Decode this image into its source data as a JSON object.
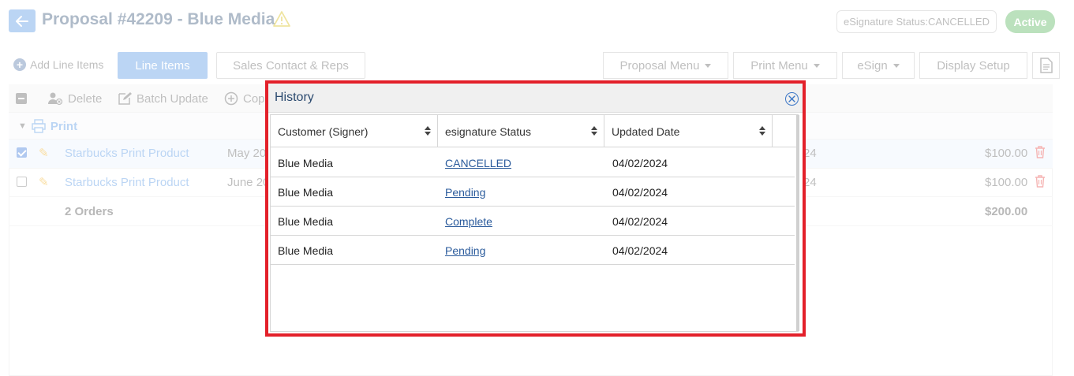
{
  "header": {
    "title": "Proposal #42209 - Blue Media",
    "esignature_status": "eSignature Status:CANCELLED",
    "status_badge": "Active"
  },
  "toolbar": {
    "add_line_items": "Add Line Items",
    "tab_line_items": "Line Items",
    "tab_sales_contact": "Sales Contact & Reps",
    "proposal_menu": "Proposal Menu",
    "print_menu": "Print Menu",
    "esign": "eSign",
    "display_setup": "Display Setup"
  },
  "grid_toolbar": {
    "delete": "Delete",
    "batch_update": "Batch Update",
    "copy": "Cop"
  },
  "grid": {
    "group_label": "Print",
    "rows": [
      {
        "product": "Starbucks Print Product",
        "date": "May 20",
        "col3": "24",
        "amount": "$100.00",
        "checked": true
      },
      {
        "product": "Starbucks Print Product",
        "date": "June 20",
        "col3": "24",
        "amount": "$100.00",
        "checked": false
      }
    ],
    "footer_count": "2 Orders",
    "footer_total": "$200.00"
  },
  "history_modal": {
    "title": "History",
    "columns": [
      "Customer (Signer)",
      "esignature Status",
      "Updated Date"
    ],
    "rows": [
      {
        "customer": "Blue Media",
        "status": "CANCELLED",
        "date": "04/02/2024"
      },
      {
        "customer": "Blue Media",
        "status": "Pending",
        "date": "04/02/2024"
      },
      {
        "customer": "Blue Media",
        "status": "Complete",
        "date": "04/02/2024"
      },
      {
        "customer": "Blue Media",
        "status": "Pending",
        "date": "04/02/2024"
      }
    ]
  },
  "colors": {
    "accent": "#4a90e2",
    "title": "#2b4a6f",
    "active_green": "#4caf50",
    "highlight_border": "#e3202a",
    "link": "#2b5b9c",
    "delete_red": "#e53935"
  }
}
